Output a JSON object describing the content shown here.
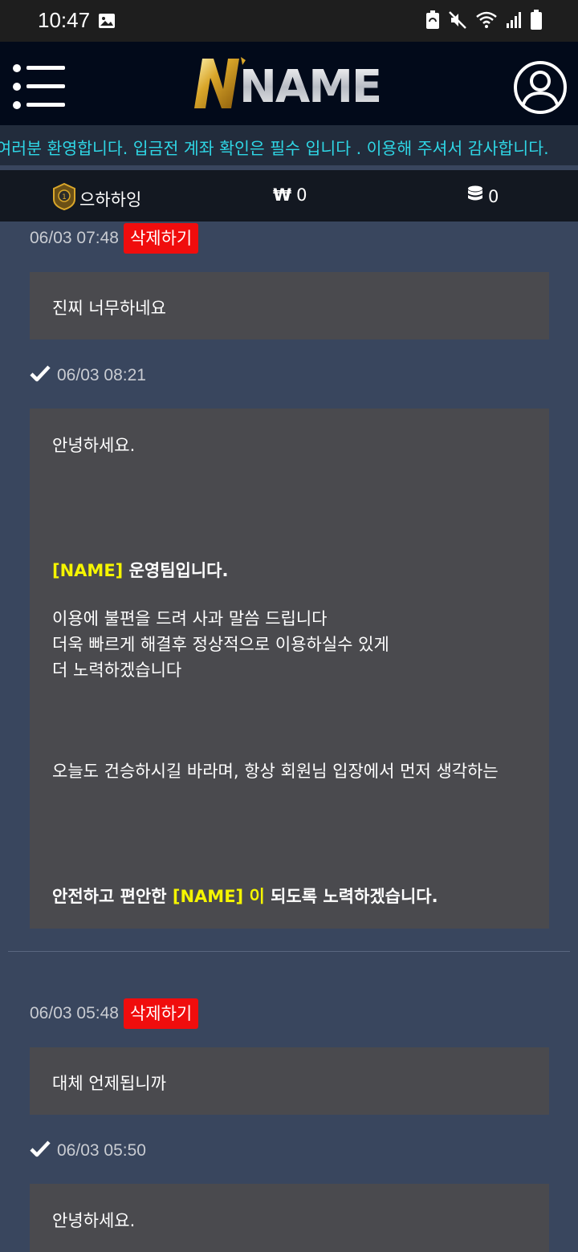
{
  "status_bar": {
    "time": "10:47",
    "icons": [
      "gallery-icon",
      "battery-saver-icon",
      "mute-icon",
      "wifi-icon",
      "signal-icon",
      "battery-icon"
    ]
  },
  "header": {
    "logo_text": "NAME",
    "menu_icon": "hamburger-menu-icon",
    "user_icon": "user-account-icon"
  },
  "notice": {
    "text": "님 여러분 환영합니다. 입금전 계좌 확인은 필수 입니다 . 이용해 주셔서 감사합니다."
  },
  "info_bar": {
    "username": "으하하잉",
    "money": "0",
    "currency_symbol": "₩",
    "points": "0"
  },
  "threads": [
    {
      "question_time": "06/03 07:48",
      "delete_label": "삭제하기",
      "question": "진찌 너무하네요",
      "answer_time": "06/03 08:21",
      "answer": {
        "greeting": "안녕하세요.",
        "team_brand": "[NAME]",
        "team_suffix": " 운영팀입니다.",
        "apology_1": "이용에 불편을 드려 사과 말씀 드립니다",
        "apology_2": "더욱 빠르게 해결후 정상적으로 이용하실수 있게",
        "apology_3": "더 노력하겠습니다",
        "wish": "오늘도 건승하시길 바라며, 항상 회원님 입장에서 먼저 생각하는",
        "closing_prefix": "안전하고 편안한 ",
        "closing_brand": "[NAME] 이",
        "closing_suffix": " 되도록 노력하겠습니다."
      }
    },
    {
      "question_time": "06/03 05:48",
      "delete_label": "삭제하기",
      "question": "대체 언제됩니까",
      "answer_time": "06/03 05:50",
      "answer": {
        "greeting": "안녕하세요."
      }
    }
  ],
  "colors": {
    "accent_cyan": "#2fd6e5",
    "delete_red": "#f00d0d",
    "brand_yellow": "#f5f500",
    "panel_bg": "#39465e",
    "message_bg": "#4a4a4e"
  }
}
